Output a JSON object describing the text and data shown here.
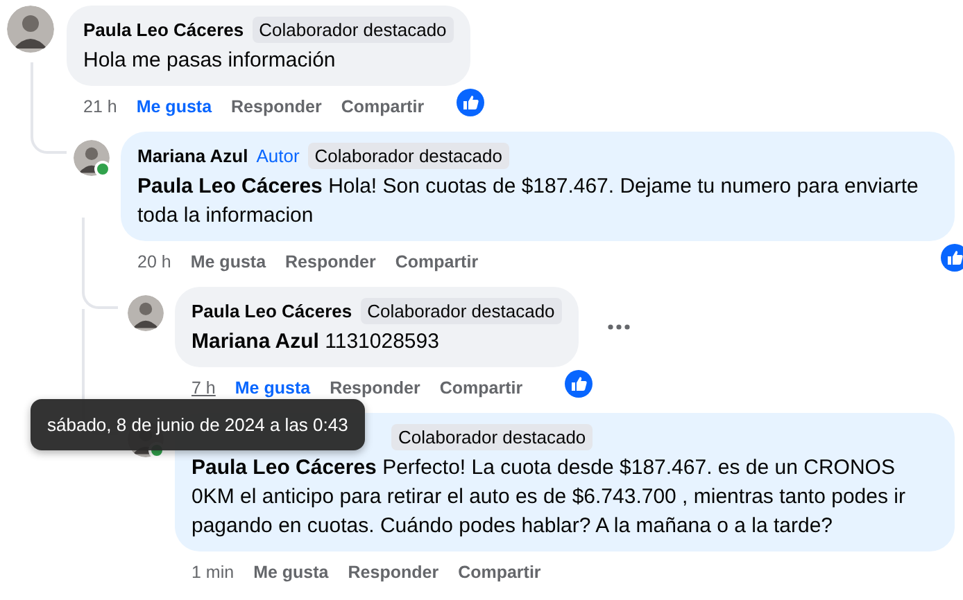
{
  "comments": [
    {
      "author": "Paula Leo Cáceres",
      "online": false,
      "badges": [
        {
          "kind": "contributor",
          "text": "Colaborador destacado"
        }
      ],
      "text": "Hola me pasas información",
      "time": "21 h",
      "time_hovered": false,
      "actions": {
        "like": "Me gusta",
        "reply": "Responder",
        "share": "Compartir"
      },
      "liked": true,
      "reaction": true,
      "menu": false,
      "color": "#f0f2f5",
      "replies": [
        {
          "author": "Mariana Azul",
          "online": true,
          "badges": [
            {
              "kind": "author",
              "text": "Autor"
            },
            {
              "kind": "contributor",
              "text": "Colaborador destacado"
            }
          ],
          "text": "**Paula Leo Cáceres** Hola! Son cuotas de $187.467. Dejame tu numero para enviarte toda la informacion",
          "time": "20 h",
          "time_hovered": false,
          "actions": {
            "like": "Me gusta",
            "reply": "Responder",
            "share": "Compartir"
          },
          "liked": false,
          "reaction": true,
          "menu": false,
          "color": "#e7f3ff",
          "replies": [
            {
              "author": "Paula Leo Cáceres",
              "online": false,
              "badges": [
                {
                  "kind": "contributor",
                  "text": "Colaborador destacado"
                }
              ],
              "text": "**Mariana Azul** 1131028593",
              "time": "7 h",
              "time_hovered": true,
              "actions": {
                "like": "Me gusta",
                "reply": "Responder",
                "share": "Compartir"
              },
              "liked": true,
              "reaction": true,
              "menu": true,
              "color": "#f0f2f5"
            },
            {
              "online": true,
              "badges": [
                {
                  "kind": "contributor",
                  "text": "Colaborador destacado"
                }
              ],
              "text": "**Paula Leo Cáceres** Perfecto! La cuota desde $187.467. es de un CRONOS 0KM el anticipo para retirar el auto es de $6.743.700 , mientras tanto podes ir pagando en cuotas. Cuándo podes hablar? A la mañana o a la tarde?",
              "time": "1 min",
              "time_hovered": false,
              "actions": {
                "like": "Me gusta",
                "reply": "Responder",
                "share": "Compartir"
              },
              "liked": false,
              "reaction": false,
              "menu": false,
              "color": "#e7f3ff"
            }
          ]
        }
      ]
    }
  ],
  "tooltip": "sábado, 8 de junio de 2024 a las 0:43"
}
